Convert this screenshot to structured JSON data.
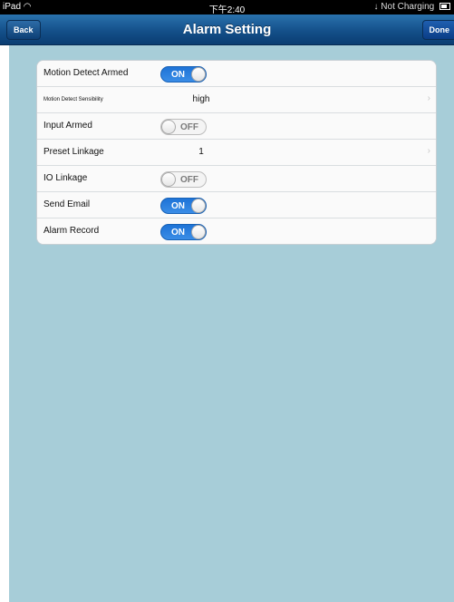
{
  "status_bar": {
    "device": "iPad",
    "wifi_icon": "wifi-icon",
    "time": "下午2:40",
    "charging_text": "Not Charging",
    "battery_icon": "battery-icon"
  },
  "nav": {
    "back_label": "Back",
    "title": "Alarm Setting",
    "done_label": "Done"
  },
  "settings": {
    "motion_detect_armed": {
      "label": "Motion Detect Armed",
      "state": "ON"
    },
    "motion_detect_sensibility": {
      "label": "Motion Detect Sensibility",
      "value": "high"
    },
    "input_armed": {
      "label": "Input Armed",
      "state": "OFF"
    },
    "preset_linkage": {
      "label": "Preset Linkage",
      "value": "1"
    },
    "io_linkage": {
      "label": "IO Linkage",
      "state": "OFF"
    },
    "send_email": {
      "label": "Send Email",
      "state": "ON"
    },
    "alarm_record": {
      "label": "Alarm Record",
      "state": "ON"
    }
  },
  "colors": {
    "background": "#a7cdd8",
    "navbar": "#14508a",
    "toggle_on": "#1e73d6"
  }
}
